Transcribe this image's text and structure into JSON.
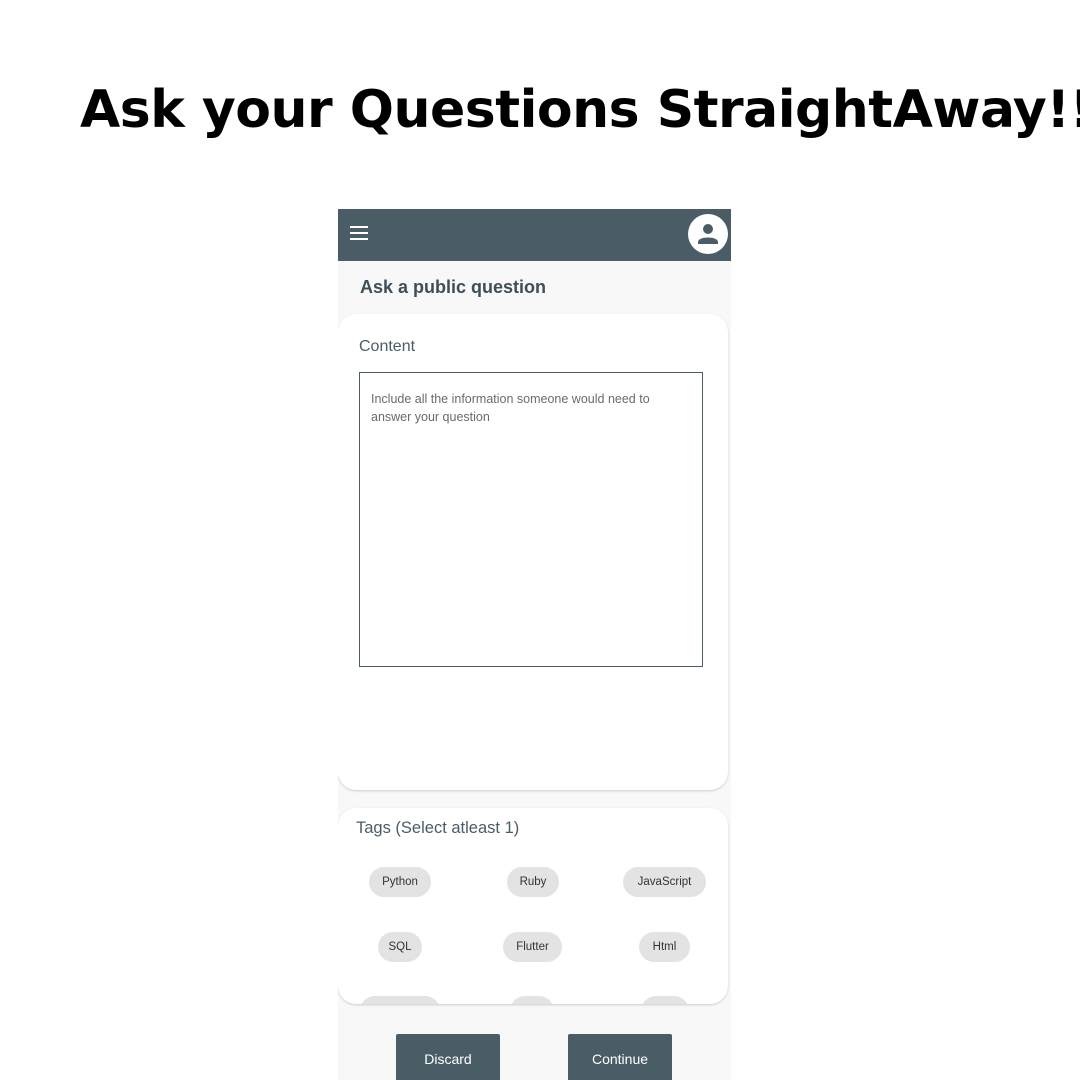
{
  "headline": "Ask your Questions StraightAway!!",
  "appbar": {
    "menu_icon": "menu-icon",
    "avatar_icon": "account-circle-icon",
    "bg_color": "#4a5d67"
  },
  "page_title": "Ask a public question",
  "content": {
    "label": "Content",
    "placeholder": "Include all the information someone would need to answer your question"
  },
  "tags": {
    "label": "Tags (Select atleast 1)",
    "items": [
      "Python",
      "Ruby",
      "JavaScript",
      "SQL",
      "Flutter",
      "Html"
    ]
  },
  "buttons": {
    "discard": "Discard",
    "continue": "Continue"
  }
}
